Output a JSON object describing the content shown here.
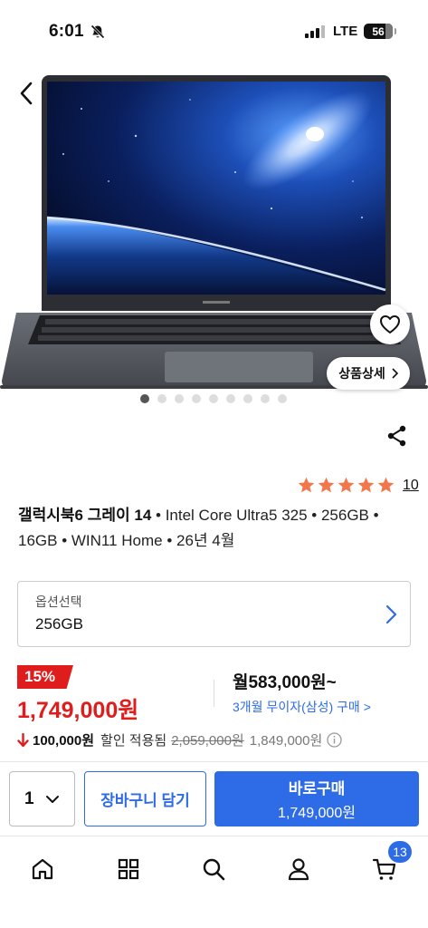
{
  "status_bar": {
    "time": "6:01",
    "network": "LTE",
    "battery": "56"
  },
  "product": {
    "title_bold": "갤럭시북6 그레이 14",
    "title_rest": " • Intel Core Ultra5 325 • 256GB • 16GB • WIN11 Home • 26년 4월",
    "rating": 5,
    "review_count": "10",
    "detail_button": "상품상세",
    "image_count": 9,
    "current_image": 1
  },
  "option": {
    "label": "옵션선택",
    "value": "256GB"
  },
  "price": {
    "discount_rate": "15%",
    "sale_price": "1,749,000원",
    "monthly": "월583,000원~",
    "installment": "3개월 무이자(삼성) 구매 >",
    "coupon_amount": "100,000원",
    "coupon_text": "할인 적용됨",
    "original_price": "2,059,000원",
    "price_before_coupon": "1,849,000원"
  },
  "purchase": {
    "quantity": "1",
    "cart_label": "장바구니 담기",
    "buy_label": "바로구매",
    "buy_price": "1,749,000원"
  },
  "tab_bar": {
    "items": [
      "home-icon",
      "grid-icon",
      "search-icon",
      "user-icon",
      "cart-icon"
    ],
    "cart_badge": "13"
  },
  "colors": {
    "accent": "#2e6be6",
    "sale": "#e01d1d",
    "star": "#f2784b"
  }
}
